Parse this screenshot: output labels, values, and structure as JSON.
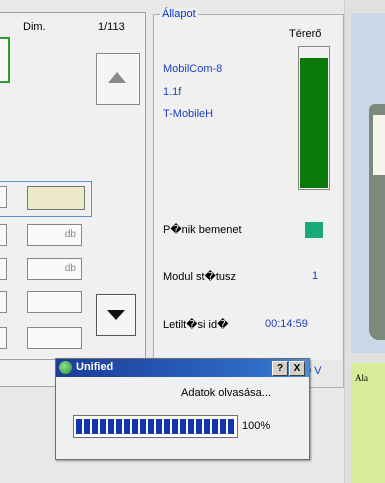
{
  "left": {
    "dim_label": "Dim.",
    "count": "1/113",
    "unit_1": "db",
    "unit_2": "db"
  },
  "status": {
    "title": "Állapot",
    "signal_label": "Térerő",
    "signal_level": 0.93,
    "networks": [
      "MobilCom-8",
      "1.1f",
      "T-MobileH"
    ],
    "panic_label": "P�nik bemenet",
    "module_label": "Modul st�tusz",
    "module_value": "1",
    "disable_label": "Letilt�si id�",
    "disable_value": "00:14:59",
    "voltage_value": "0 V"
  },
  "right_panel": {
    "label": "Ala"
  },
  "dialog": {
    "title": "Unified",
    "help": "?",
    "close": "X",
    "message": "Adatok olvasása...",
    "progress": 100,
    "progress_text": "100%"
  },
  "colors": {
    "signal_green": "#0a7a0a",
    "panic_led": "#1aa97a",
    "title_blue": "#1c3c98",
    "text_blue": "#1a3fc0"
  }
}
